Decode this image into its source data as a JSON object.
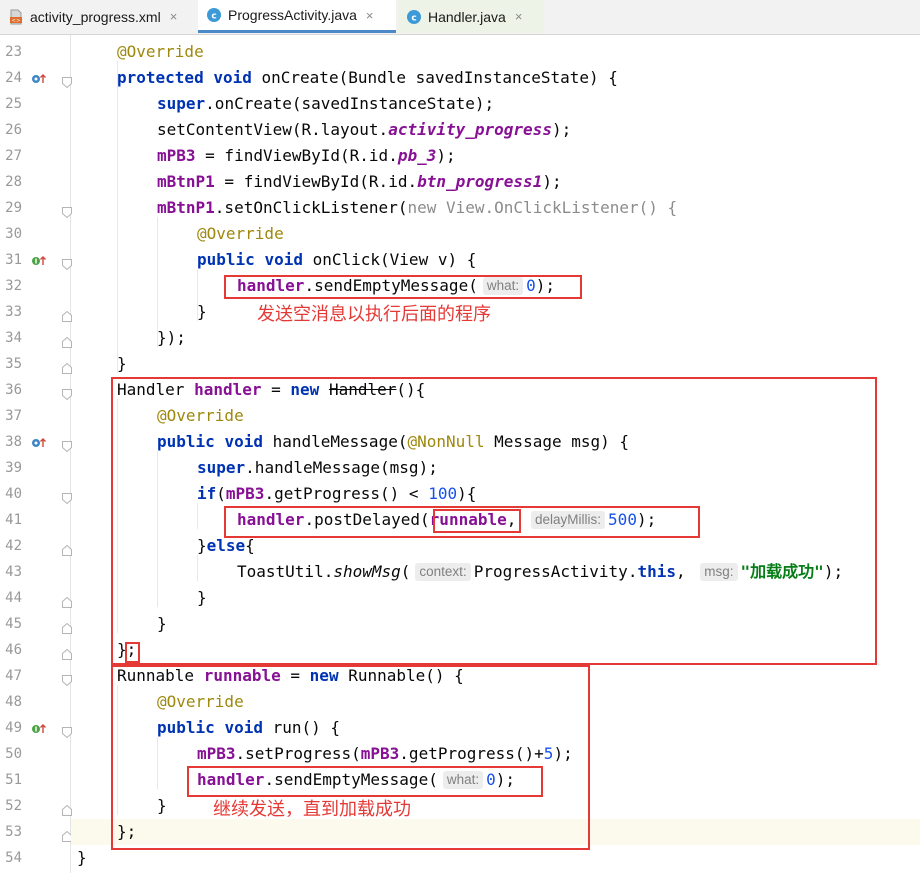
{
  "tabs": [
    {
      "label": "activity_progress.xml",
      "icon": "xml-file-icon",
      "active": false
    },
    {
      "label": "ProgressActivity.java",
      "icon": "java-class-icon",
      "active": true
    },
    {
      "label": "Handler.java",
      "icon": "java-class-icon",
      "active": false
    }
  ],
  "tab_close_glyph": "×",
  "colors": {
    "keyword": "#0033b3",
    "annotation": "#9e880d",
    "field": "#871094",
    "number": "#1750eb",
    "string": "#067d17",
    "annotation_box": "#e53935"
  },
  "line_numbers": [
    "23",
    "24",
    "25",
    "26",
    "27",
    "28",
    "29",
    "30",
    "31",
    "32",
    "33",
    "34",
    "35",
    "36",
    "37",
    "38",
    "39",
    "40",
    "41",
    "42",
    "43",
    "44",
    "45",
    "46",
    "47",
    "48",
    "49",
    "50",
    "51",
    "52",
    "53",
    "54"
  ],
  "current_line": "53",
  "code": {
    "override": "@Override",
    "protected": "protected",
    "public": "public",
    "void": "void",
    "new": "new",
    "super": "super",
    "this": "this",
    "if": "if",
    "else": "else",
    "oncreate_sig": " onCreate(Bundle savedInstanceState) {",
    "super_oncreate": ".onCreate(savedInstanceState);",
    "setcontentview": "setContentView(R.layout.",
    "activity_progress": "activity_progress",
    "close_paren_semi": ");",
    "mpb3": "mPB3",
    "mbtnp1": "mBtnP1",
    "find_eq": " = findViewById(R.id.",
    "pb_3": "pb_3",
    "btn_progress1": "btn_progress1",
    "set_listener": ".setOnClickListener(",
    "view_listener": " View.OnClickListener() {",
    "onclick_sig": " onClick(View v) {",
    "handler": "handler",
    "send_empty": ".sendEmptyMessage(",
    "hint_what": "what:",
    "zero": "0",
    "close_brace": "}",
    "close_anon": "});",
    "handler_type": "Handler ",
    "eq": " = ",
    "handler_ctor": "Handler",
    "handler_open": "(){",
    "handle_message_sig": " handleMessage(",
    "nonnull": "@NonNull",
    "message_msg": " Message msg) {",
    "super_handle": ".handleMessage(msg);",
    "get_progress": ".getProgress() < ",
    "hundred": "100",
    "brace_open_paren": "){",
    "post_delayed": ".postDelayed(",
    "runnable": "runnable",
    "comma": ",",
    "hint_delay": "delayMillis:",
    "five_hundred": "500",
    "else_open": "}else{",
    "toast_util": "ToastUtil.",
    "show_msg": "showMsg",
    "open_paren": "(",
    "hint_context": "context:",
    "progress_activity": "ProgressActivity.",
    "comma_space": ",",
    "hint_msg": "msg:",
    "toast_text": "\"加载成功\"",
    "end_semi": "};",
    "runnable_type": "Runnable ",
    "runnable_ctor": " Runnable() {",
    "run_sig": " run() {",
    "set_progress": ".setProgress(",
    "get_progress_plus": ".getProgress()+",
    "five": "5"
  },
  "annotations": {
    "note_send_empty": "发送空消息以执行后面的程序",
    "note_continue": "继续发送，直到加载成功"
  }
}
